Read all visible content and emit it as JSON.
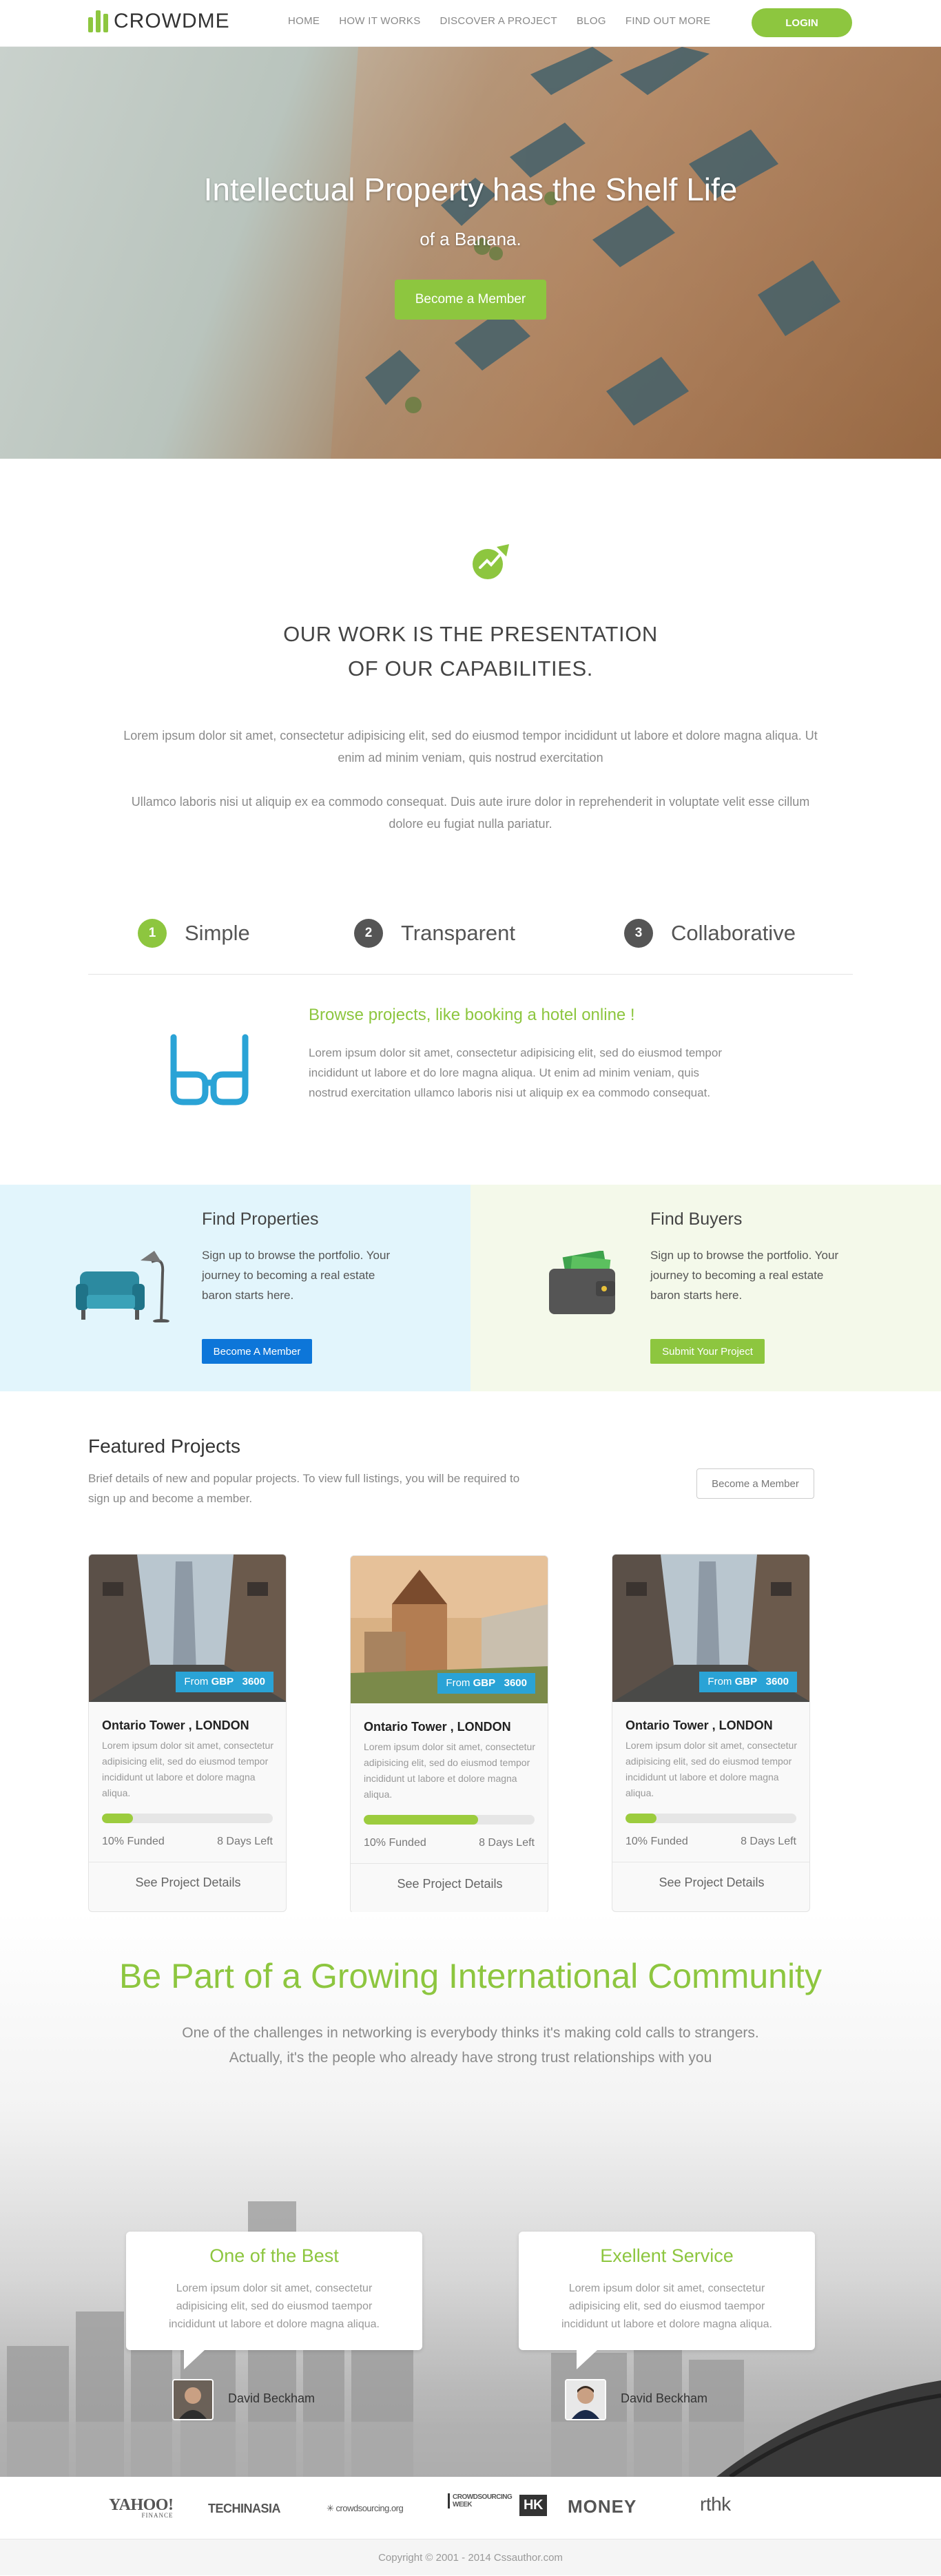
{
  "brand": {
    "name": "CROWDME",
    "accent": "#8dc63f",
    "blue": "#2aa3d6"
  },
  "nav": {
    "items": [
      "HOME",
      "HOW IT WORKS",
      "DISCOVER A PROJECT",
      "BLOG",
      "FIND OUT MORE"
    ],
    "login": "LOGIN"
  },
  "hero": {
    "title": "Intellectual Property has the Shelf Life",
    "subtitle": "of a Banana.",
    "cta": "Become a Member"
  },
  "intro": {
    "title_line1": "OUR WORK IS THE PRESENTATION",
    "title_line2": "OF OUR CAPABILITIES.",
    "p1": "Lorem ipsum dolor sit amet, consectetur adipisicing elit, sed do eiusmod tempor incididunt ut labore et dolore magna aliqua. Ut enim ad minim veniam, quis nostrud exercitation",
    "p2": "Ullamco laboris nisi ut aliquip ex ea commodo consequat. Duis aute irure dolor in reprehenderit in voluptate velit esse cillum dolore eu fugiat nulla pariatur."
  },
  "steps": [
    {
      "num": "1",
      "label": "Simple",
      "color": "#8dc63f"
    },
    {
      "num": "2",
      "label": "Transparent",
      "color": "#555555"
    },
    {
      "num": "3",
      "label": "Collaborative",
      "color": "#555555"
    }
  ],
  "browse": {
    "title": "Browse projects, like booking a hotel online !",
    "text": "Lorem ipsum dolor sit amet, consectetur adipisicing elit, sed do eiusmod tempor incididunt ut labore et do lore magna aliqua. Ut enim ad minim veniam, quis nostrud exercitation ullamco laboris nisi ut aliquip ex ea commodo consequat."
  },
  "properties": {
    "title": "Find Properties",
    "text": "Sign up to browse the portfolio. Your journey to becoming a real estate baron starts here.",
    "button": "Become A Member"
  },
  "buyers": {
    "title": "Find Buyers",
    "text": "Sign up to browse the portfolio. Your journey to becoming a real estate baron starts here.",
    "button": "Submit Your Project"
  },
  "featured": {
    "title": "Featured Projects",
    "text": "Brief details of new and popular projects. To view full listings, you will be required to sign up and become a member.",
    "button": "Become a Member",
    "cards": [
      {
        "price_prefix": "From ",
        "currency": "GBP",
        "price": "3600",
        "title": "Ontario Tower , LONDON",
        "desc": "Lorem ipsum dolor sit amet, consectetur adipisicing elit, sed do eiusmod tempor incididunt ut labore et dolore magna aliqua.",
        "funded_pct": 0.18,
        "funded": "10% Funded",
        "days": "8 Days Left",
        "link": "See Project Details"
      },
      {
        "price_prefix": "From ",
        "currency": "GBP",
        "price": "3600",
        "title": "Ontario Tower , LONDON",
        "desc": "Lorem ipsum dolor sit amet, consectetur adipisicing elit, sed do eiusmod tempor incididunt ut labore et dolore magna aliqua.",
        "funded_pct": 0.67,
        "funded": "10% Funded",
        "days": "8 Days Left",
        "link": "See Project Details"
      },
      {
        "price_prefix": "From ",
        "currency": "GBP",
        "price": "3600",
        "title": "Ontario Tower , LONDON",
        "desc": "Lorem ipsum dolor sit amet, consectetur adipisicing elit, sed do eiusmod tempor incididunt ut labore et dolore magna aliqua.",
        "funded_pct": 0.18,
        "funded": "10% Funded",
        "days": "8 Days Left",
        "link": "See Project Details"
      }
    ]
  },
  "community": {
    "title": "Be Part of a Growing International Community",
    "line1": "One of the challenges in networking is everybody thinks it's making cold calls to strangers.",
    "line2": "Actually, it's the people who already have strong trust relationships with you",
    "testimonials": [
      {
        "title": "One of the Best",
        "text": "Lorem ipsum dolor sit amet, consectetur adipisicing elit, sed do eiusmod taempor incididunt ut labore et dolore magna aliqua.",
        "author": "David Beckham"
      },
      {
        "title": "Exellent Service",
        "text": "Lorem ipsum dolor sit amet, consectetur adipisicing elit, sed do eiusmod taempor incididunt ut labore et dolore magna aliqua.",
        "author": "David Beckham"
      }
    ]
  },
  "partners": [
    "YAHOO!",
    "FINANCE",
    "TECHINASIA",
    "crowdsourcing.org",
    "CROWDSOURCING WEEK",
    "HK",
    "MONEY",
    "rthk"
  ],
  "footer": {
    "copyright": "Copyright © 2001 - 2014 Cssauthor.com"
  }
}
